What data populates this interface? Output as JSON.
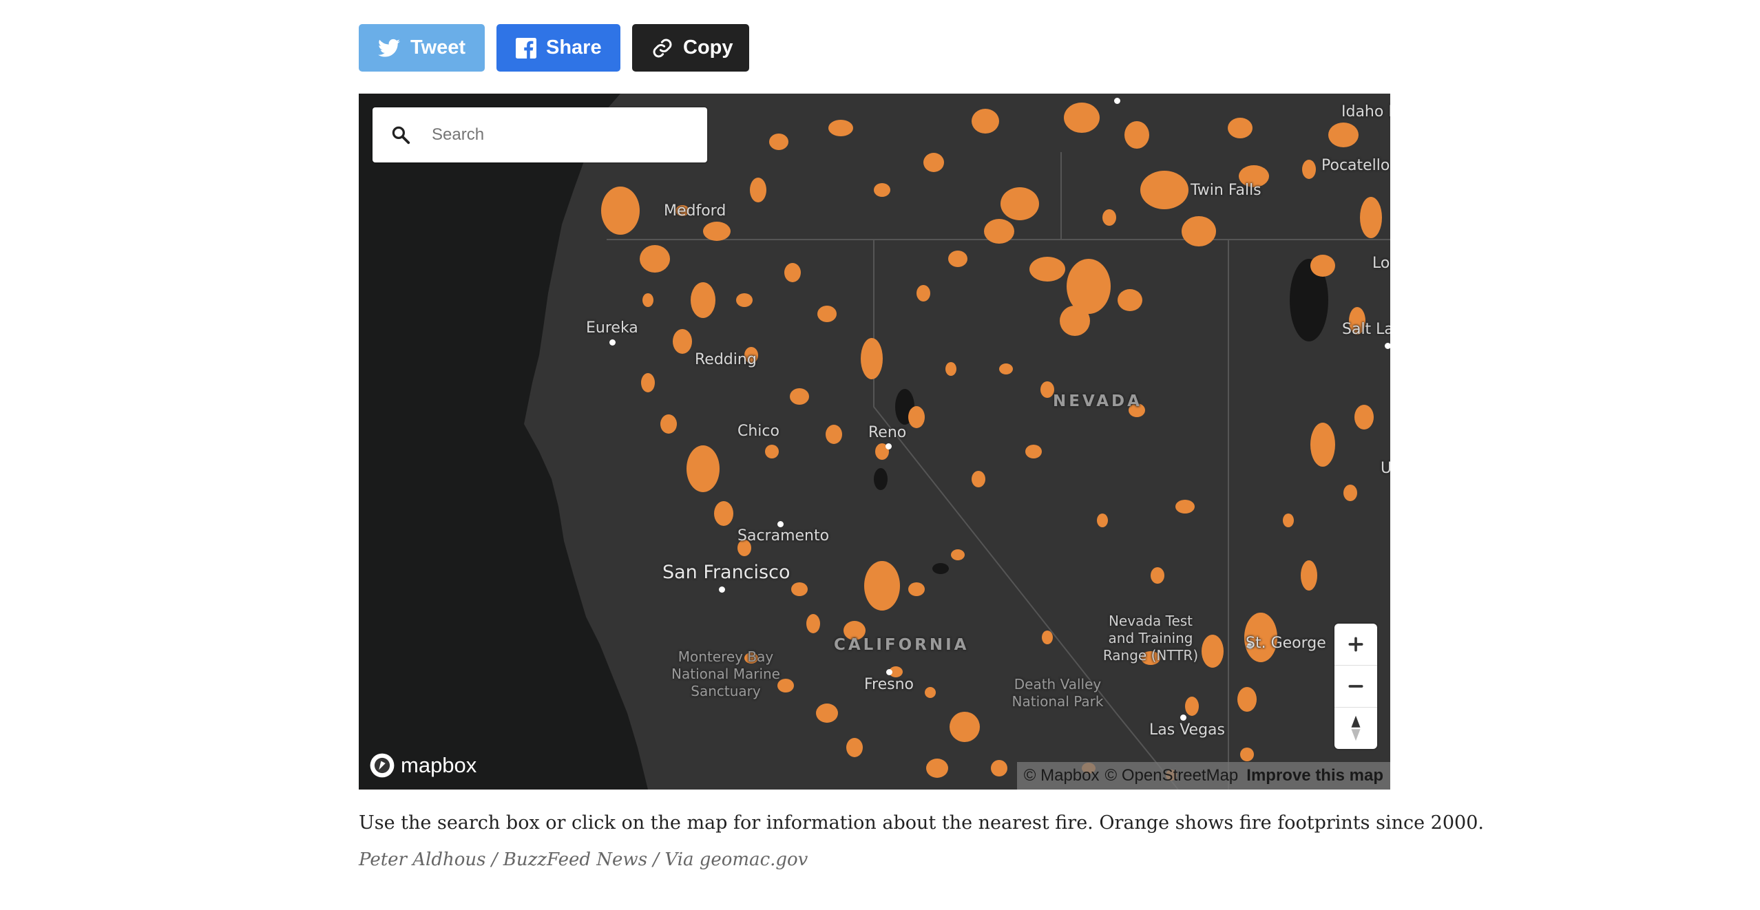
{
  "share": {
    "tweet_label": "Tweet",
    "share_label": "Share",
    "copy_label": "Copy",
    "colors": {
      "tweet": "#6aaee8",
      "share": "#2f74e6",
      "copy": "#222222"
    }
  },
  "map": {
    "search_placeholder": "Search",
    "labels": {
      "medford": "Medford",
      "eureka": "Eureka",
      "redding": "Redding",
      "chico": "Chico",
      "reno": "Reno",
      "sacramento": "Sacramento",
      "san_francisco": "San Francisco",
      "fresno": "Fresno",
      "las_vegas": "Las Vegas",
      "st_george": "St. George",
      "twin_falls": "Twin Falls",
      "pocatello": "Pocatello",
      "idaho_falls": "Idaho F",
      "salt_lake": "Salt La",
      "logan": "Lo",
      "utah_edge": "U",
      "nevada": "NEVADA",
      "california": "CALIFORNIA",
      "monterey": "Monterey Bay National Marine Sanctuary",
      "death_valley": "Death Valley National Park",
      "nttr": "Nevada Test and Training Range (NTTR)"
    },
    "attribution": {
      "mapbox": "© Mapbox",
      "osm": "© OpenStreetMap",
      "improve": "Improve this map"
    },
    "logo_text": "mapbox",
    "colors": {
      "land": "#343434",
      "ocean": "#1a1b1b",
      "fire": "#e8893a",
      "lakes": "#161616"
    }
  },
  "caption": "Use the search box or click on the map for information about the nearest fire. Orange shows fire footprints since 2000.",
  "credit": "Peter Aldhous / BuzzFeed News / Via geomac.gov"
}
